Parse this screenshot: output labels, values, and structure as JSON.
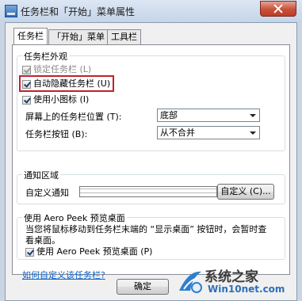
{
  "window": {
    "title": "任务栏和「开始」菜单属性"
  },
  "tabs": [
    {
      "label": "任务栏"
    },
    {
      "label": "「开始」菜单"
    },
    {
      "label": "工具栏"
    }
  ],
  "appearance": {
    "group_label": "任务栏外观",
    "lock_taskbar": {
      "label": "锁定任务栏 (L)",
      "checked": true,
      "disabled": true
    },
    "auto_hide": {
      "label": "自动隐藏任务栏 (U)",
      "checked": true
    },
    "small_icons": {
      "label": "使用小图标 (I)",
      "checked": true
    },
    "position": {
      "label": "屏幕上的任务栏位置 (T):",
      "value": "底部"
    },
    "buttons": {
      "label": "任务栏按钮 (B):",
      "value": "从不合并"
    }
  },
  "notification": {
    "group_label": "通知区域",
    "desc": "自定义通知",
    "customize_button": "自定义 (C)..."
  },
  "aero_peek": {
    "group_label": "使用 Aero Peek 预览桌面",
    "desc": "当您将鼠标移动到任务栏末端的 “显示桌面” 按钮时，会暂时查看桌面。",
    "checkbox": {
      "label": "使用 Aero Peek 预览桌面 (P)",
      "checked": true
    }
  },
  "help_link": "如何自定义该任务栏?",
  "footer": {
    "ok_button": "确定"
  },
  "watermark": {
    "brand": "系统之家",
    "url": "Win10net.com"
  }
}
